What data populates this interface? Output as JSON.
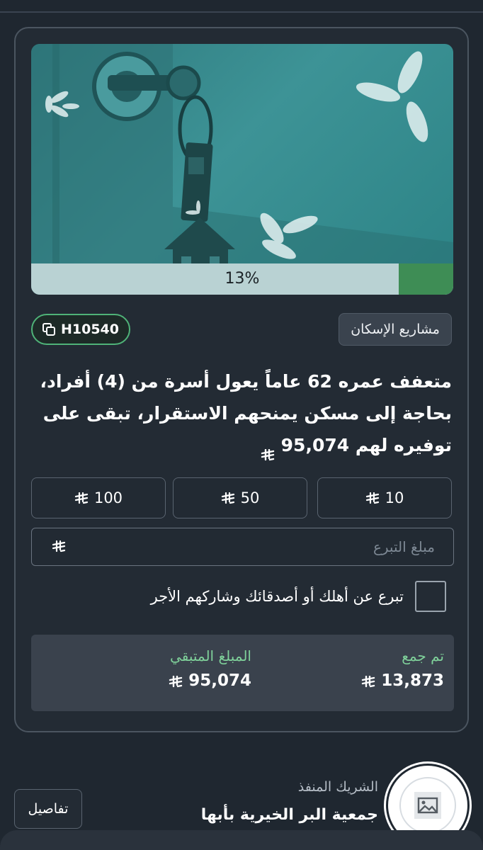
{
  "project": {
    "progress_label": "13%",
    "progress_fraction": 0.13,
    "category": "مشاريع الإسكان",
    "code": "H10540",
    "description": "متعفف عمره 62 عاماً  يعول أسرة من (4) أفراد، بحاجة إلى مسكن يمنحهم الاستقرار، تبقى على توفيره لهم 95,074"
  },
  "donation": {
    "amounts": [
      "10",
      "50",
      "100"
    ],
    "input_placeholder": "مبلغ التبرع",
    "gift_label": "تبرع عن أهلك أو أصدقائك وشاركهم الأجر"
  },
  "stats": {
    "collected_label": "تم جمع",
    "collected_value": "13,873",
    "remaining_label": "المبلغ المتبقي",
    "remaining_value": "95,074"
  },
  "partner": {
    "label": "الشريك المنفذ",
    "name": "جمعية البر الخيرية بأبها",
    "details_label": "تفاصيل"
  },
  "colors": {
    "accent_green": "#3e8d55",
    "label_green": "#7fd19a"
  }
}
